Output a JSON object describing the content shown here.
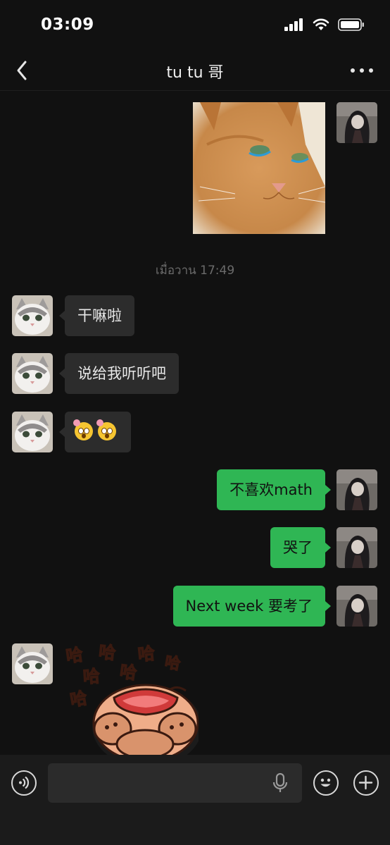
{
  "status_bar": {
    "time": "03:09"
  },
  "chat": {
    "title": "tu tu 哥"
  },
  "messages": {
    "timestamp": "เมื่อวาน 17:49",
    "m1": "干嘛啦",
    "m2": "说给我听听吧",
    "m4": "不喜欢math",
    "m5": "哭了",
    "m6": "Next week 要考了"
  },
  "sticker": {
    "laugh_text_1": "哈",
    "laugh_text_2": "哈",
    "laugh_text_3": "哈",
    "laugh_text_4": "哈",
    "laugh_text_5": "哈",
    "laugh_text_6": "哈",
    "laugh_text_7": "哈"
  },
  "input": {
    "value": ""
  },
  "colors": {
    "background": "#111111",
    "bubble_in": "#2c2c2c",
    "bubble_out": "#2fb654",
    "input_bar": "#1b1b1b"
  },
  "icons": [
    "back-icon",
    "more-icon",
    "voice-icon",
    "mic-icon",
    "emoji-icon",
    "plus-icon",
    "signal-icon",
    "wifi-icon",
    "battery-icon"
  ]
}
